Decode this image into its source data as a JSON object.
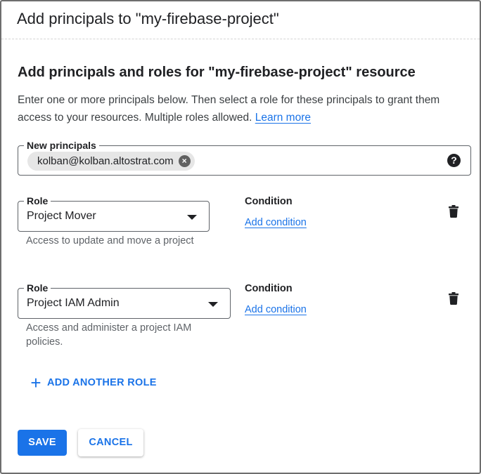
{
  "dialog": {
    "title": "Add principals to \"my-firebase-project\""
  },
  "section": {
    "heading": "Add principals and roles for \"my-firebase-project\" resource",
    "description": "Enter one or more principals below. Then select a role for these principals to grant them access to your resources. Multiple roles allowed.",
    "learn_more": "Learn more"
  },
  "principals": {
    "label": "New principals",
    "chips": [
      "kolban@kolban.altostrat.com"
    ],
    "help_icon": "help-icon"
  },
  "roles": [
    {
      "label": "Role",
      "value": "Project Mover",
      "hint": "Access to update and move a project",
      "condition_label": "Condition",
      "add_condition": "Add condition"
    },
    {
      "label": "Role",
      "value": "Project IAM Admin",
      "hint": "Access and administer a project IAM policies.",
      "condition_label": "Condition",
      "add_condition": "Add condition"
    }
  ],
  "add_another_role": "ADD ANOTHER ROLE",
  "buttons": {
    "save": "SAVE",
    "cancel": "CANCEL"
  },
  "colors": {
    "accent": "#1a73e8",
    "text": "#202124",
    "hint": "#5f6368"
  }
}
